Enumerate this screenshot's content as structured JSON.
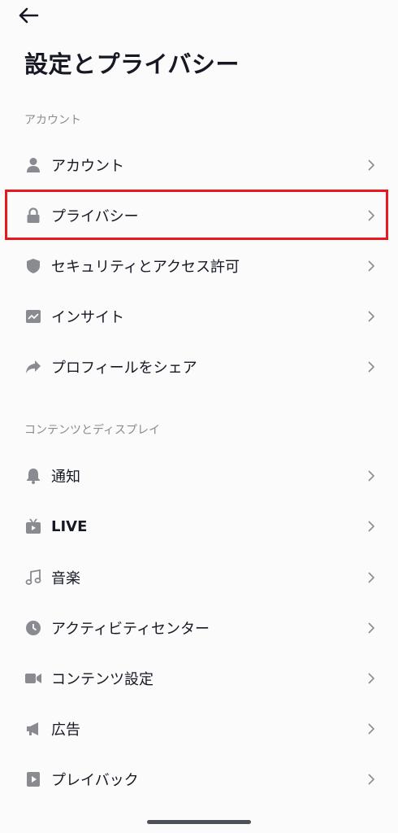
{
  "page": {
    "title": "設定とプライバシー"
  },
  "sections": [
    {
      "header": "アカウント",
      "items": [
        {
          "label": "アカウント",
          "icon": "person-icon"
        },
        {
          "label": "プライバシー",
          "icon": "lock-icon",
          "highlighted": true
        },
        {
          "label": "セキュリティとアクセス許可",
          "icon": "shield-icon"
        },
        {
          "label": "インサイト",
          "icon": "insights-chart-icon"
        },
        {
          "label": "プロフィールをシェア",
          "icon": "share-arrow-icon"
        }
      ]
    },
    {
      "header": "コンテンツとディスプレイ",
      "items": [
        {
          "label": "通知",
          "icon": "bell-icon"
        },
        {
          "label": "LIVE",
          "icon": "tv-live-icon"
        },
        {
          "label": "音楽",
          "icon": "music-note-icon"
        },
        {
          "label": "アクティビティセンター",
          "icon": "clock-icon"
        },
        {
          "label": "コンテンツ設定",
          "icon": "video-camera-icon"
        },
        {
          "label": "広告",
          "icon": "megaphone-icon"
        },
        {
          "label": "プレイバック",
          "icon": "playback-icon"
        }
      ]
    }
  ],
  "colors": {
    "icon": "#8a8b91",
    "highlight_border": "#e8191d",
    "section_header": "#8a8b91",
    "text": "#161823"
  }
}
